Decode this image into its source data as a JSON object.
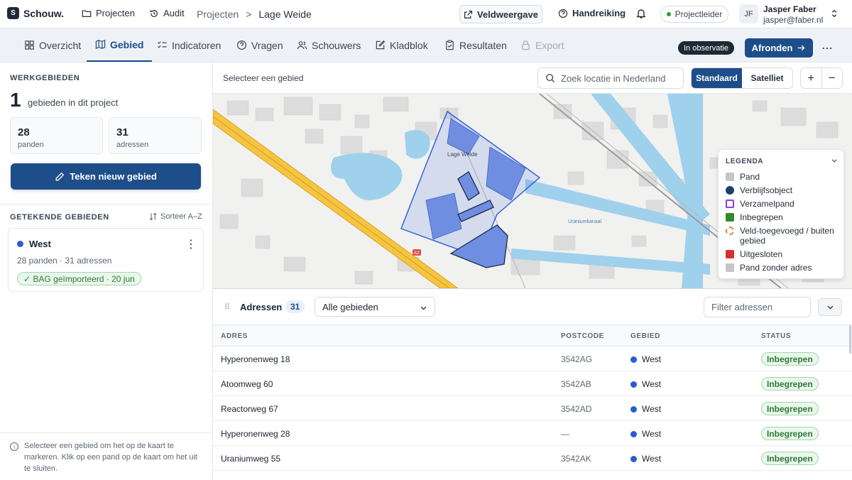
{
  "app": {
    "name": "Schouw."
  },
  "topnav": {
    "projects": "Projecten",
    "audit": "Audit"
  },
  "breadcrumb": {
    "root": "Projecten",
    "separator": ">",
    "current": "Lage Weide"
  },
  "header": {
    "field_view": "Veldweergave",
    "help": "Handreiking",
    "role": "Projectleider"
  },
  "user": {
    "initials": "JF",
    "name": "Jasper Faber",
    "email": "jasper@faber.nl"
  },
  "tabs": [
    {
      "label": "Overzicht",
      "icon": "grid-icon"
    },
    {
      "label": "Gebied",
      "icon": "map-icon",
      "active": true
    },
    {
      "label": "Indicatoren",
      "icon": "checklist-icon"
    },
    {
      "label": "Vragen",
      "icon": "question-icon"
    },
    {
      "label": "Schouwers",
      "icon": "users-icon"
    },
    {
      "label": "Kladblok",
      "icon": "edit-icon"
    },
    {
      "label": "Resultaten",
      "icon": "clipboard-icon"
    },
    {
      "label": "Export",
      "icon": "lock-icon",
      "disabled": true
    }
  ],
  "status_badge": "In observatie",
  "finish_button": "Afronden",
  "sidebar": {
    "title": "WERKGEBIEDEN",
    "count": "1",
    "count_caption": "gebieden in dit project",
    "stats": [
      {
        "value": "28",
        "label": "panden"
      },
      {
        "value": "31",
        "label": "adressen"
      }
    ],
    "draw_button": "Teken nieuw gebied",
    "drawn_title": "GETEKENDE GEBIEDEN",
    "sort_label": "Sorteer A–Z",
    "areas": [
      {
        "name": "West",
        "meta": "28 panden · 31 adressen",
        "badge": "✓ BAG geïmporteerd · 20 jun",
        "color": "#2a5bd7"
      }
    ],
    "hint": "Selecteer een gebied om het op de kaart te markeren. Klik op een pand op de kaart om het uit te sluiten."
  },
  "map_toolbar": {
    "hint": "Selecteer een gebied",
    "search_placeholder": "Zoek locatie in Nederland",
    "standard": "Standaard",
    "satellite": "Satelliet",
    "zoom_in": "+",
    "zoom_out": "−"
  },
  "map": {
    "area_label": "Lage Weide",
    "canal_label": "Uraniumkanaal",
    "road_shield": "A2"
  },
  "legend": {
    "title": "LEGENDA",
    "items": [
      {
        "label": "Pand",
        "color": "#c6c6c6"
      },
      {
        "label": "Verblijfsobject",
        "color": "#1d3f6e"
      },
      {
        "label": "Verzamelpand",
        "color": "#8a3fd9"
      },
      {
        "label": "Inbegrepen",
        "color": "#2f8a2f"
      },
      {
        "label": "Veld-toegevoegd / buiten gebied",
        "color": "#d18a3a"
      },
      {
        "label": "Uitgesloten",
        "color": "#d6322f"
      },
      {
        "label": "Pand zonder adres",
        "color": "#c6c6c6"
      }
    ]
  },
  "addresses": {
    "title": "Adressen",
    "count": "31",
    "area_filter": "Alle gebieden",
    "filter_placeholder": "Filter adressen",
    "columns": [
      "ADRES",
      "POSTCODE",
      "GEBIED",
      "STATUS"
    ],
    "rows": [
      {
        "address": "Hyperonenweg 18",
        "postcode": "3542AG",
        "area": "West",
        "status": "Inbegrepen"
      },
      {
        "address": "Atoomweg 60",
        "postcode": "3542AB",
        "area": "West",
        "status": "Inbegrepen"
      },
      {
        "address": "Reactorweg 67",
        "postcode": "3542AD",
        "area": "West",
        "status": "Inbegrepen"
      },
      {
        "address": "Hyperonenweg 28",
        "postcode": "—",
        "area": "West",
        "status": "Inbegrepen"
      },
      {
        "address": "Uraniumweg 55",
        "postcode": "3542AK",
        "area": "West",
        "status": "Inbegrepen"
      }
    ]
  }
}
